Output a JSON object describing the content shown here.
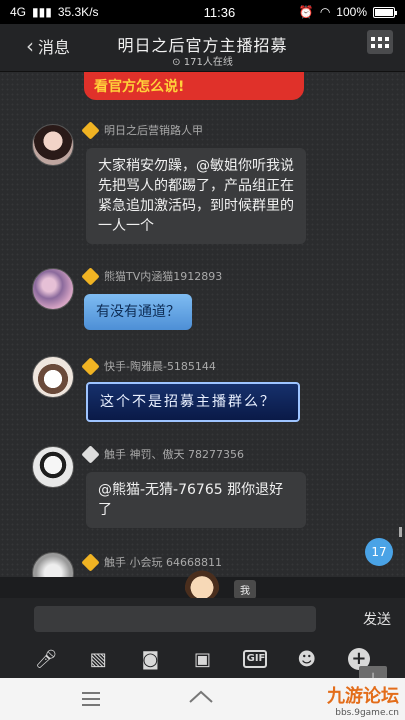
{
  "status_bar": {
    "network": "4G",
    "speed": "35.3K/s",
    "time": "11:36",
    "battery": "100%",
    "battery_level": 1.0
  },
  "header": {
    "back_label": "消息",
    "title": "明日之后官方主播招募",
    "online_count": "171人在线"
  },
  "messages": [
    {
      "type": "cropped",
      "text": "看官方怎么说!"
    },
    {
      "nick": "明日之后营销路人甲",
      "text": "大家稍安勿躁，@敏姐你听我说 先把骂人的都踢了，产品组正在紧急追加激活码，到时候群里的一人一个"
    },
    {
      "nick": "熊猫TV内涵猫1912893",
      "text": "有没有通道？"
    },
    {
      "nick": "快手-陶雅晨-5185144",
      "text": "这个不是招募主播群么？"
    },
    {
      "nick": "触手 神罚、傲天 78277356",
      "text": "@熊猫-无猜-76765 那你退好了"
    },
    {
      "nick": "触手 小会玩 64668811",
      "text": ""
    }
  ],
  "unread_count": "17",
  "me_label": "我",
  "input": {
    "placeholder": "",
    "send_label": "发送"
  },
  "toolbar": {
    "gif_label": "GIF"
  },
  "watermark": {
    "brand": "九游论坛",
    "url": "bbs.9game.cn"
  }
}
